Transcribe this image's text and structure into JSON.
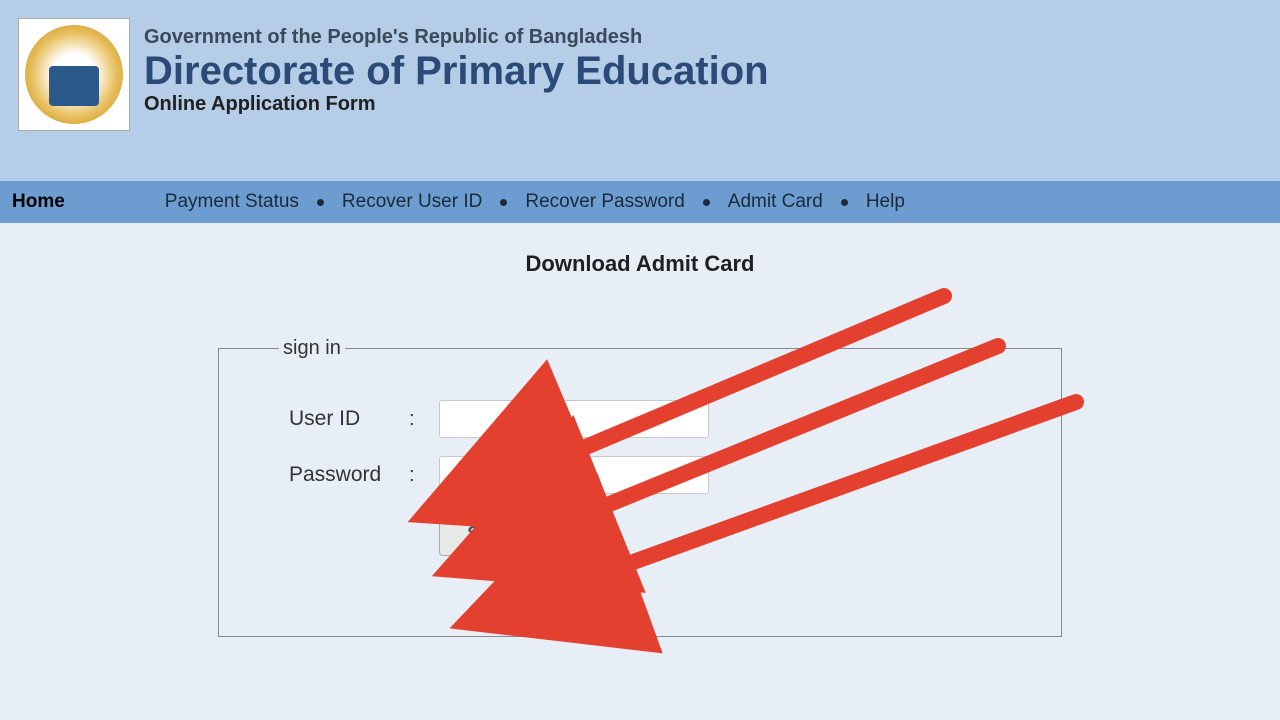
{
  "header": {
    "gov_line": "Government of the People's Republic of Bangladesh",
    "directorate": "Directorate of Primary Education",
    "subtitle": "Online Application Form"
  },
  "nav": {
    "home": "Home",
    "items": [
      "Payment Status",
      "Recover User ID",
      "Recover Password",
      "Admit Card",
      "Help"
    ]
  },
  "page": {
    "title": "Download Admit Card",
    "legend": "sign in",
    "user_id_label": "User ID",
    "password_label": "Password",
    "colon": ":",
    "user_id_value": "",
    "password_value": "",
    "submit_label": "Submit"
  }
}
